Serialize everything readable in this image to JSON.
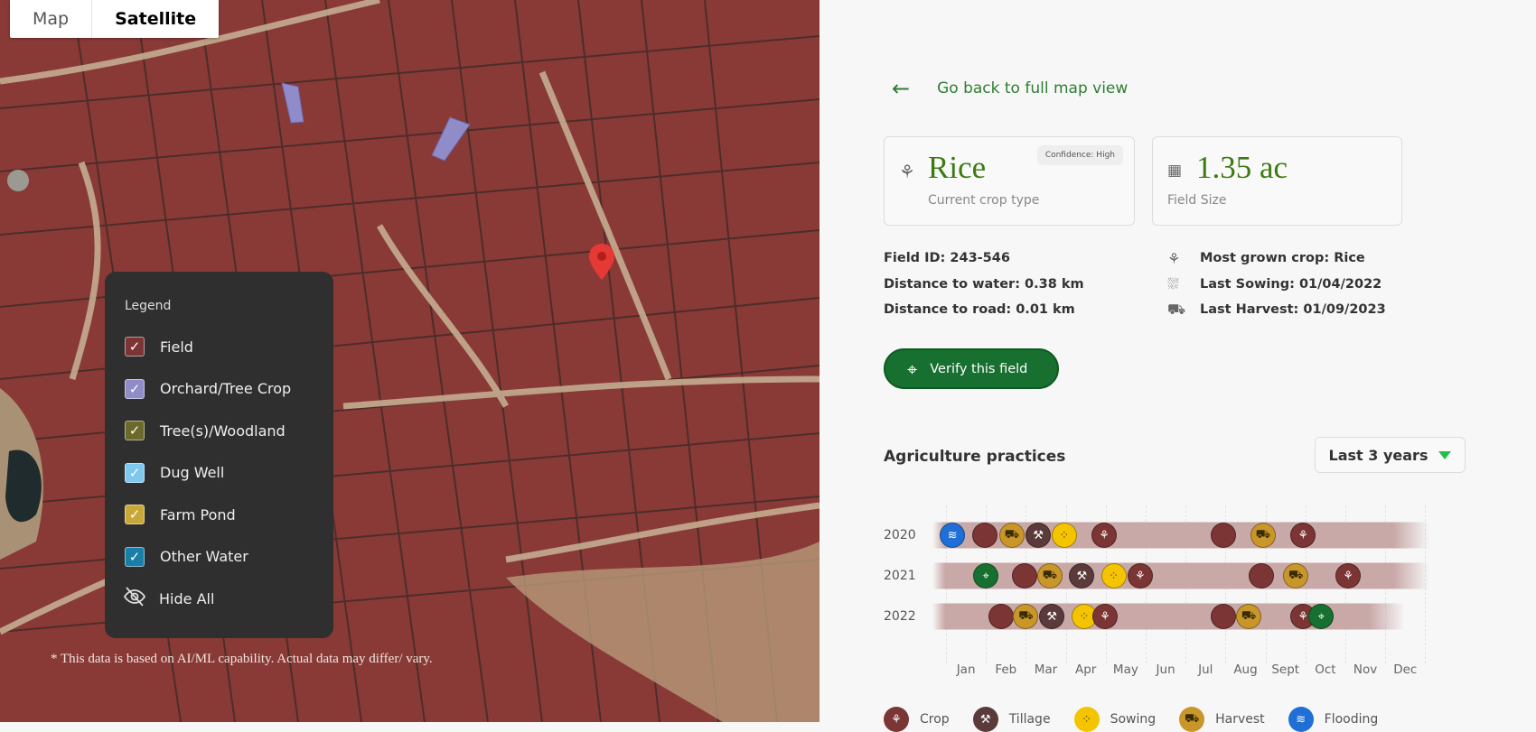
{
  "map": {
    "toggle": [
      "Map",
      "Satellite"
    ],
    "active_toggle": "Satellite",
    "legend": {
      "title": "Legend",
      "items": [
        {
          "label": "Field",
          "color": "#7b3535",
          "checked": true
        },
        {
          "label": "Orchard/Tree Crop",
          "color": "#8f8cc9",
          "checked": true
        },
        {
          "label": "Tree(s)/Woodland",
          "color": "#6b6a2a",
          "checked": true
        },
        {
          "label": "Dug Well",
          "color": "#7ec8f0",
          "checked": true
        },
        {
          "label": "Farm Pond",
          "color": "#c9a838",
          "checked": true
        },
        {
          "label": "Other Water",
          "color": "#1a7fa8",
          "checked": true
        }
      ],
      "hide_all": "Hide All"
    },
    "disclaimer": "* This data is based on AI/ML capability. Actual data may differ/ vary."
  },
  "panel": {
    "back_label": "Go back to full map view",
    "crop_card": {
      "value": "Rice",
      "label": "Current crop type",
      "confidence": "Confidence: High"
    },
    "size_card": {
      "value": "1.35 ac",
      "label": "Field Size"
    },
    "field_info": [
      "Field ID: 243-546",
      "Distance to water: 0.38 km",
      "Distance to road: 0.01 km"
    ],
    "crop_info": [
      {
        "icon": "crop-icon",
        "text": "Most grown crop: Rice"
      },
      {
        "icon": "sowing-icon",
        "text": "Last Sowing: 01/04/2022"
      },
      {
        "icon": "tractor-icon",
        "text": "Last Harvest: 01/09/2023"
      }
    ],
    "verify_label": "Verify this field",
    "practices_title": "Agriculture practices",
    "period": "Last 3 years"
  },
  "timeline": {
    "months": [
      "Jan",
      "Feb",
      "Mar",
      "Apr",
      "May",
      "Jun",
      "Jul",
      "Aug",
      "Sept",
      "Oct",
      "Nov",
      "Dec"
    ],
    "colors": {
      "crop": "#7b3535",
      "crop-plain": "#7b3535",
      "tillage": "#5a3a3a",
      "sowing": "#f5c400",
      "harvest": "#c9962a",
      "flooding": "#1f6fd6",
      "verify": "#17702f",
      "bar": "#c9a8a8"
    },
    "rows": [
      {
        "year": "2020",
        "bar": [
          -0.35,
          12.1
        ],
        "events": [
          {
            "type": "flooding",
            "month": 0.16
          },
          {
            "type": "crop-plain",
            "month": 0.97
          },
          {
            "type": "harvest",
            "month": 1.65
          },
          {
            "type": "tillage",
            "month": 2.31
          },
          {
            "type": "sowing",
            "month": 2.96
          },
          {
            "type": "crop",
            "month": 3.96
          },
          {
            "type": "crop-plain",
            "month": 6.95
          },
          {
            "type": "harvest",
            "month": 7.94
          },
          {
            "type": "crop",
            "month": 8.94
          }
        ]
      },
      {
        "year": "2021",
        "bar": [
          -0.35,
          12.1
        ],
        "events": [
          {
            "type": "verify",
            "month": 1.0
          },
          {
            "type": "crop-plain",
            "month": 1.97
          },
          {
            "type": "harvest",
            "month": 2.6
          },
          {
            "type": "tillage",
            "month": 3.4
          },
          {
            "type": "sowing",
            "month": 4.2
          },
          {
            "type": "crop",
            "month": 4.86
          },
          {
            "type": "crop-plain",
            "month": 7.9
          },
          {
            "type": "harvest",
            "month": 8.76
          },
          {
            "type": "crop",
            "month": 10.07
          }
        ]
      },
      {
        "year": "2022",
        "bar": [
          -0.35,
          11.5
        ],
        "events": [
          {
            "type": "crop-plain",
            "month": 1.38
          },
          {
            "type": "harvest",
            "month": 2.0
          },
          {
            "type": "tillage",
            "month": 2.65
          },
          {
            "type": "sowing",
            "month": 3.46
          },
          {
            "type": "crop",
            "month": 3.98
          },
          {
            "type": "crop-plain",
            "month": 6.95
          },
          {
            "type": "harvest",
            "month": 7.58
          },
          {
            "type": "crop",
            "month": 8.94
          },
          {
            "type": "verify",
            "month": 9.4
          }
        ]
      }
    ],
    "legend": [
      {
        "type": "crop",
        "label": "Crop"
      },
      {
        "type": "tillage",
        "label": "Tillage"
      },
      {
        "type": "sowing",
        "label": "Sowing"
      },
      {
        "type": "harvest",
        "label": "Harvest"
      },
      {
        "type": "flooding",
        "label": "Flooding"
      }
    ]
  }
}
